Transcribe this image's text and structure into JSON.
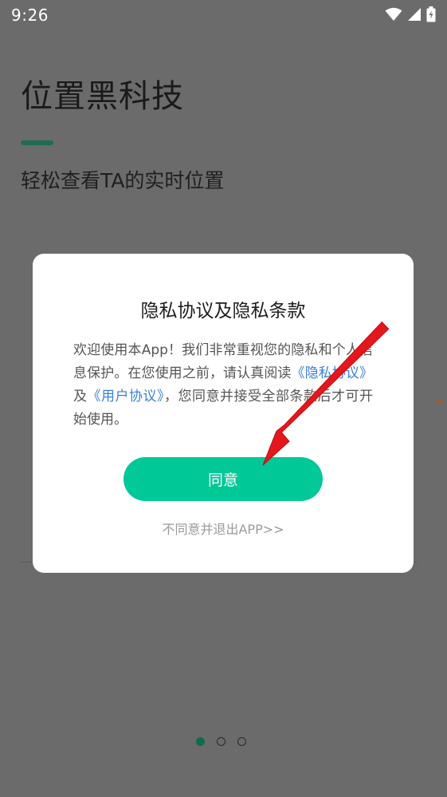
{
  "status_bar": {
    "time": "9:26"
  },
  "background": {
    "app_title": "位置黑科技",
    "subtitle": "轻松查看TA的实时位置"
  },
  "dialog": {
    "title": "隐私协议及隐私条款",
    "body_prefix": "欢迎使用本App！我们非常重视您的隐私和个人信息保护。在您使用之前，请认真阅读",
    "privacy_link": "《隐私协议》",
    "conj": "及",
    "user_link": "《用户协议》",
    "body_suffix": "，您同意并接受全部条款后才可开始使用。",
    "agree_label": "同意",
    "exit_label": "不同意并退出APP>>"
  },
  "colors": {
    "accent_green": "#00c896",
    "link_blue": "#3c7fd6",
    "annotation_red": "#e4171c"
  },
  "pager": {
    "count": 3,
    "active_index": 0
  }
}
